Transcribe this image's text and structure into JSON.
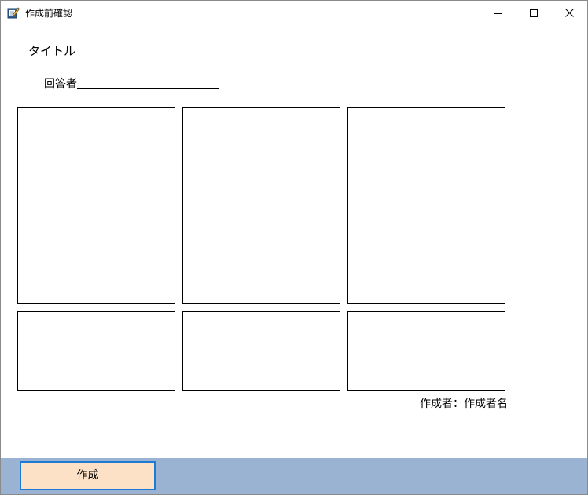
{
  "window": {
    "title": "作成前確認",
    "icon": "edit-document-icon",
    "controls": {
      "minimize": "minimize-icon",
      "maximize": "maximize-icon",
      "close": "close-icon"
    }
  },
  "form": {
    "title": "タイトル",
    "respondent_label": "回答者",
    "author_text": "作成者：作成者名"
  },
  "footer": {
    "create_label": "作成"
  },
  "colors": {
    "footer_bg": "#9ab3d2",
    "button_bg": "#fde1c6",
    "button_border": "#1f7ad6"
  }
}
